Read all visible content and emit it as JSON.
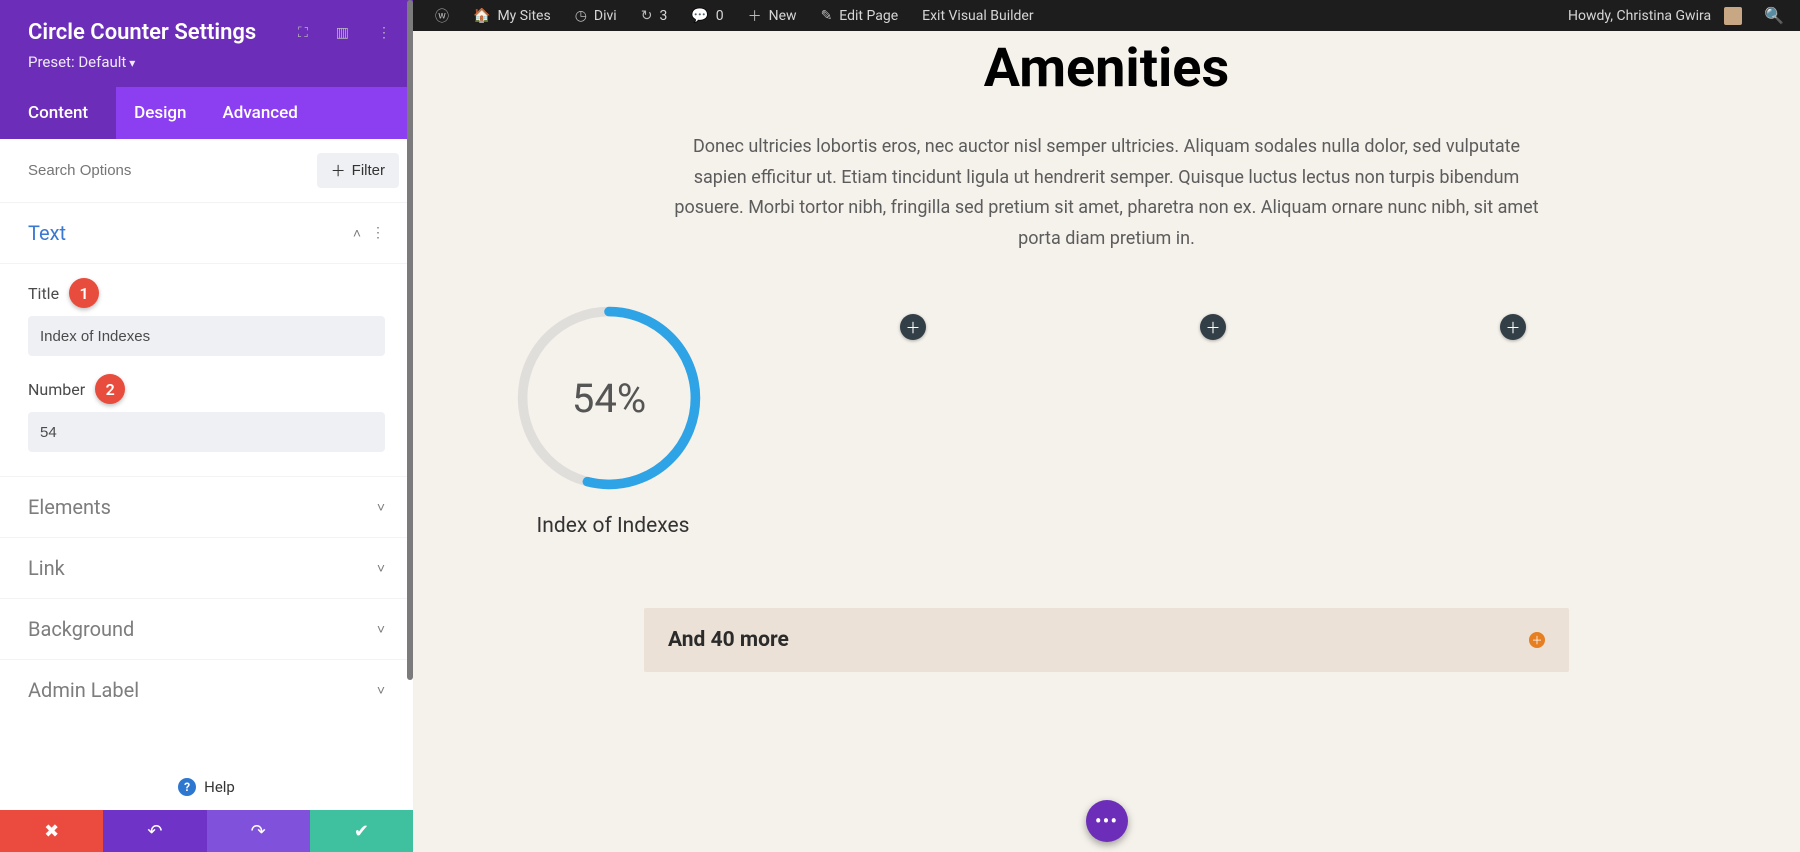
{
  "sidebar": {
    "title": "Circle Counter Settings",
    "preset_label": "Preset: Default",
    "tabs": {
      "content": "Content",
      "design": "Design",
      "advanced": "Advanced"
    },
    "search_placeholder": "Search Options",
    "filter_label": "Filter",
    "sections": {
      "text": {
        "label": "Text",
        "title_field_label": "Title",
        "title_value": "Index of Indexes",
        "number_field_label": "Number",
        "number_value": "54",
        "badges": {
          "title": "1",
          "number": "2"
        }
      },
      "elements_label": "Elements",
      "link_label": "Link",
      "background_label": "Background",
      "admin_label": "Admin Label"
    },
    "help_label": "Help"
  },
  "wpbar": {
    "my_sites": "My Sites",
    "divi": "Divi",
    "updates_count": "3",
    "comments_count": "0",
    "new_label": "New",
    "edit_page": "Edit Page",
    "exit_visual": "Exit Visual Builder",
    "greeting": "Howdy, Christina Gwira"
  },
  "main": {
    "page_title": "Amenities",
    "intro": "Donec ultricies lobortis eros, nec auctor nisl semper ultricies. Aliquam sodales nulla dolor, sed vulputate sapien efficitur ut. Etiam tincidunt ligula ut hendrerit semper. Quisque luctus lectus non turpis bibendum posuere. Morbi tortor nibh, fringilla sed pretium sit amet, pharetra non ex. Aliquam ornare nunc nibh, sit amet porta diam pretium in.",
    "circle_percent": 54,
    "circle_percent_display": "54%",
    "circle_title": "Index of Indexes",
    "more_label": "And 40 more"
  }
}
